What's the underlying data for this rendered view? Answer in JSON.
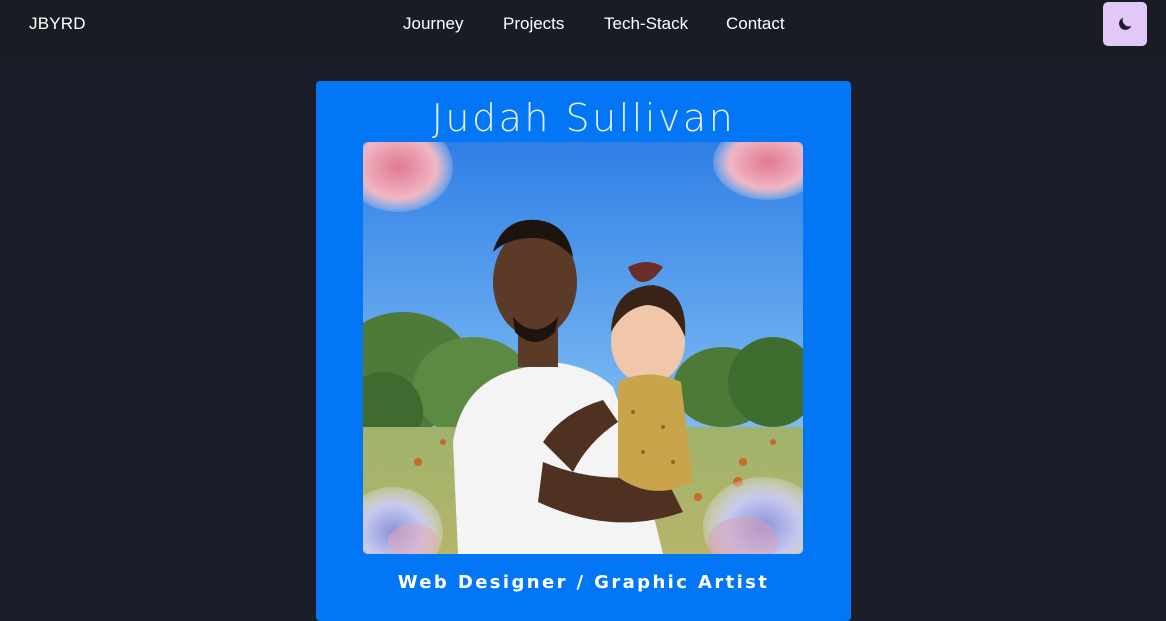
{
  "brand": "JBYRD",
  "nav": {
    "journey": "Journey",
    "projects": "Projects",
    "tech_stack": "Tech-Stack",
    "contact": "Contact"
  },
  "theme_toggle": {
    "icon": "moon-icon",
    "background": "#e2c8f7"
  },
  "profile": {
    "name": "Judah Sullivan",
    "role": "Web Designer / Graphic Artist",
    "card_color": "#0376f5",
    "photo_icon": "profile-photo"
  },
  "colors": {
    "page_background": "#1b1e28",
    "navbar_background": "#191c25"
  }
}
